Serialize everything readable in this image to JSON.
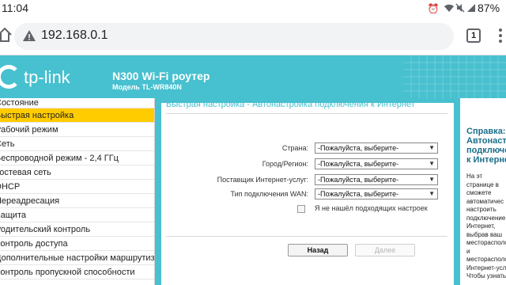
{
  "status_bar": {
    "time": "11:04",
    "battery": "87%",
    "icons": [
      "alarm-icon",
      "wifi-icon",
      "mute-icon",
      "signal-icon"
    ]
  },
  "browser": {
    "url": "192.168.0.1",
    "tab_count": "1",
    "icons": [
      "home-icon",
      "not-secure-warning-icon",
      "tab-switcher-icon",
      "overflow-menu-icon"
    ]
  },
  "router": {
    "brand": "tp-link",
    "product_name": "N300 Wi-Fi роутер",
    "model": "Модель TL-WR840N",
    "accent_color": "#47c0cf",
    "active_menu_color": "#ffcc00"
  },
  "menu": {
    "items": [
      {
        "label": "Состояние",
        "active": false
      },
      {
        "label": "Быстрая настройка",
        "active": true
      },
      {
        "label": "Рабочий режим",
        "active": false
      },
      {
        "label": "Сеть",
        "active": false
      },
      {
        "label": "Беспроводной режим - 2,4 ГГц",
        "active": false
      },
      {
        "label": "Гостевая сеть",
        "active": false
      },
      {
        "label": "DHCP",
        "active": false
      },
      {
        "label": "Переадресация",
        "active": false
      },
      {
        "label": "Защита",
        "active": false
      },
      {
        "label": "Родительский контроль",
        "active": false
      },
      {
        "label": "Контроль доступа",
        "active": false
      },
      {
        "label": "Дополнительные настройки маршрутизации",
        "active": false
      },
      {
        "label": "Контроль пропускной способности",
        "active": false
      }
    ]
  },
  "content": {
    "title": "Быстрая настройка - Автонастройка подключения к Интернет",
    "fields": [
      {
        "label": "Страна:",
        "value": "-Пожалуйста, выберите-"
      },
      {
        "label": "Город/Регион:",
        "value": "-Пожалуйста, выберите-"
      },
      {
        "label": "Поставщик Интернет-услуг:",
        "value": "-Пожалуйста, выберите-"
      },
      {
        "label": "Тип подключения WAN:",
        "value": "-Пожалуйста, выберите-"
      }
    ],
    "checkbox_label": "Я не нашёл подходящих настроек",
    "checkbox_checked": false,
    "back_button": "Назад",
    "next_button": "Далее"
  },
  "help": {
    "title": "Справка:\nАвтонаст\nподключе\nк Интерне",
    "text": "На        эт\nстранице   в\nсможете\nавтоматичес\nнастроить\nподключение\nИнтернет,\nвыбрав   ваш\nместорасполо\nи\nместорасполо\nИнтернет-услу\nЧтобы  узнать"
  }
}
